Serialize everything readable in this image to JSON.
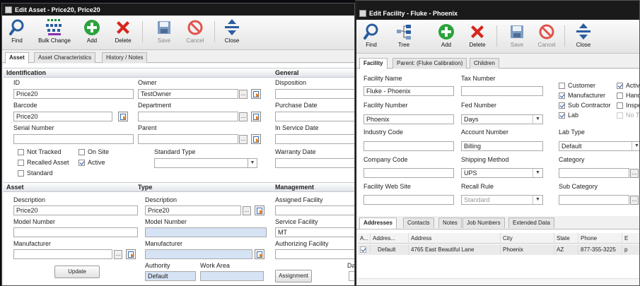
{
  "asset_window": {
    "title": "Edit Asset - Price20, Price20",
    "toolbar": [
      {
        "label": "Find",
        "icon": "magnifier-icon",
        "disabled": false
      },
      {
        "label": "Bulk Change",
        "icon": "bulk-change-icon",
        "disabled": false
      },
      {
        "label": "Add",
        "icon": "add-icon",
        "disabled": false
      },
      {
        "label": "Delete",
        "icon": "delete-icon",
        "disabled": false
      },
      {
        "label": "Save",
        "icon": "save-icon",
        "disabled": true
      },
      {
        "label": "Cancel",
        "icon": "cancel-icon",
        "disabled": true
      },
      {
        "label": "Close",
        "icon": "close-icon",
        "disabled": false
      }
    ],
    "tabs": [
      "Asset",
      "Asset Characteristics",
      "History / Notes"
    ],
    "identification": {
      "header": "Identification",
      "id_label": "ID",
      "id_value": "Price20",
      "owner_label": "Owner",
      "owner_value": "TestOwner",
      "barcode_label": "Barcode",
      "barcode_value": "Price20",
      "department_label": "Department",
      "department_value": "",
      "serial_label": "Serial Number",
      "serial_value": "",
      "parent_label": "Parent",
      "parent_value": "",
      "standard_type_label": "Standard Type",
      "standard_type_value": "",
      "checkboxes": [
        {
          "label": "Not Tracked",
          "checked": false
        },
        {
          "label": "On Site",
          "checked": false
        },
        {
          "label": "Recalled Asset",
          "checked": false
        },
        {
          "label": "Active",
          "checked": true
        },
        {
          "label": "Standard",
          "checked": false
        }
      ]
    },
    "general": {
      "header": "General",
      "disposition_label": "Disposition",
      "purchase_date_label": "Purchase Date",
      "in_service_date_label": "In Service Date",
      "warranty_date_label": "Warranty Date"
    },
    "asset_section": {
      "header": "Asset",
      "description_label": "Description",
      "description_value": "Price20",
      "model_number_label": "Model Number",
      "model_number_value": "",
      "manufacturer_label": "Manufacturer",
      "manufacturer_value": "",
      "update_button": "Update"
    },
    "type_section": {
      "header": "Type",
      "description_label": "Description",
      "description_value": "Price20",
      "model_number_label": "Model Number",
      "model_number_value": "",
      "manufacturer_label": "Manufacturer",
      "manufacturer_value": "",
      "authority_label": "Authority",
      "authority_value": "Default",
      "work_area_label": "Work Area",
      "work_area_value": ""
    },
    "management": {
      "header": "Management",
      "assigned_facility_label": "Assigned Facility",
      "assigned_facility_value": "",
      "service_facility_label": "Service Facility",
      "service_facility_value": "MT",
      "authorizing_facility_label": "Authorizing Facility",
      "authorizing_facility_value": "",
      "assignment_button": "Assignment",
      "truncated_label": "Da"
    }
  },
  "facility_window": {
    "title": "Edit Facility - Fluke - Phoenix",
    "toolbar": [
      {
        "label": "Find",
        "icon": "magnifier-icon",
        "disabled": false
      },
      {
        "label": "Tree",
        "icon": "tree-icon",
        "disabled": false
      },
      {
        "label": "Add",
        "icon": "add-icon",
        "disabled": false
      },
      {
        "label": "Delete",
        "icon": "delete-icon",
        "disabled": false
      },
      {
        "label": "Save",
        "icon": "save-icon",
        "disabled": true
      },
      {
        "label": "Cancel",
        "icon": "cancel-icon",
        "disabled": true
      },
      {
        "label": "Close",
        "icon": "close-icon",
        "disabled": false
      }
    ],
    "tabs": [
      "Facility",
      "Parent: (Fluke Calibration)",
      "Children"
    ],
    "facility_name_label": "Facility Name",
    "facility_name_value": "Fluke - Phoenix",
    "tax_number_label": "Tax Number",
    "tax_number_value": "",
    "facility_number_label": "Facility Number",
    "facility_number_value": "Phoenix",
    "fed_number_label": "Fed Number",
    "fed_number_value": "Days",
    "industry_code_label": "Industry Code",
    "industry_code_value": "",
    "account_number_label": "Account Number",
    "account_number_value": "Billing",
    "company_code_label": "Company Code",
    "company_code_value": "",
    "shipping_method_label": "Shipping Method",
    "shipping_method_value": "UPS",
    "web_site_label": "Facility Web Site",
    "web_site_value": "",
    "recall_rule_label": "Recall Rule",
    "recall_rule_value": "Standard",
    "lab_type_label": "Lab Type",
    "lab_type_value": "Default",
    "category_label": "Category",
    "category_value": "",
    "sub_category_label": "Sub Category",
    "sub_category_value": "",
    "checkboxes_col1": [
      {
        "label": "Customer",
        "checked": false,
        "disabled": false
      },
      {
        "label": "Manufacturer",
        "checked": true,
        "disabled": false
      },
      {
        "label": "Sub Contractor",
        "checked": true,
        "disabled": false
      },
      {
        "label": "Lab",
        "checked": true,
        "disabled": false
      }
    ],
    "checkboxes_col2": [
      {
        "label": "Activ",
        "checked": true,
        "disabled": false
      },
      {
        "label": "Hand",
        "checked": false,
        "disabled": false
      },
      {
        "label": "Inspe",
        "checked": false,
        "disabled": false
      },
      {
        "label": "No T",
        "checked": false,
        "disabled": true
      }
    ],
    "bottom_tabs": [
      "Addresses",
      "Contacts",
      "Notes",
      "Job Numbers",
      "Extended Data"
    ],
    "grid_columns": [
      "A...",
      "Addres...",
      "Address",
      "City",
      "State",
      "Phone",
      "E"
    ],
    "grid_rows": [
      {
        "checked": true,
        "type": "Default",
        "address": "4765 East Beautiful Lane",
        "city": "Phoenix",
        "state": "AZ",
        "phone": "877-355-3225",
        "extra": "p"
      }
    ]
  }
}
